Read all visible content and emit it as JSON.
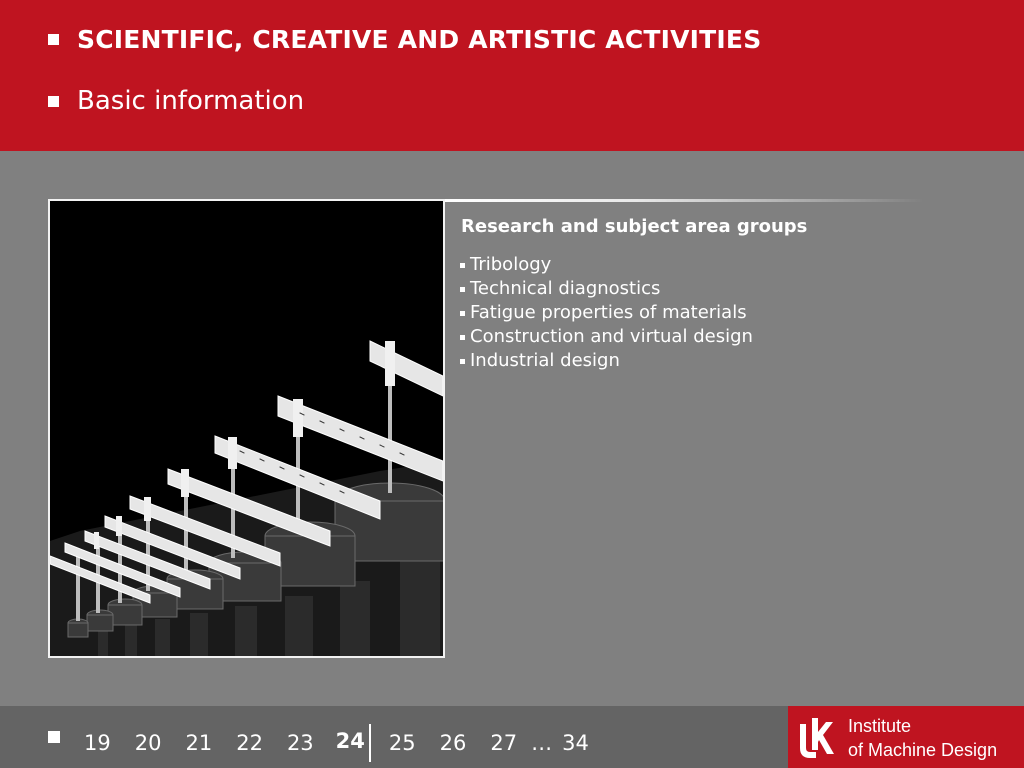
{
  "header": {
    "title": "SCIENTIFIC, CREATIVE AND ARTISTIC ACTIVITIES",
    "subtitle": "Basic information"
  },
  "content": {
    "groups_title": "Research and subject area groups",
    "groups": [
      "Tribology",
      "Technical diagnostics",
      "Fatigue properties of materials",
      "Construction and virtual design",
      "Industrial design"
    ],
    "photo_icon": "fatigue-testing-machines-photo"
  },
  "footer": {
    "pages": [
      "19",
      "20",
      "21",
      "22",
      "23"
    ],
    "current_page": "24",
    "pages_after": [
      "25",
      "26",
      "27"
    ],
    "ellipsis": "…",
    "last_page": "34"
  },
  "logo": {
    "line1": "Institute",
    "line2": "of Machine Design",
    "colors": {
      "brand_red": "#bf1420"
    }
  }
}
